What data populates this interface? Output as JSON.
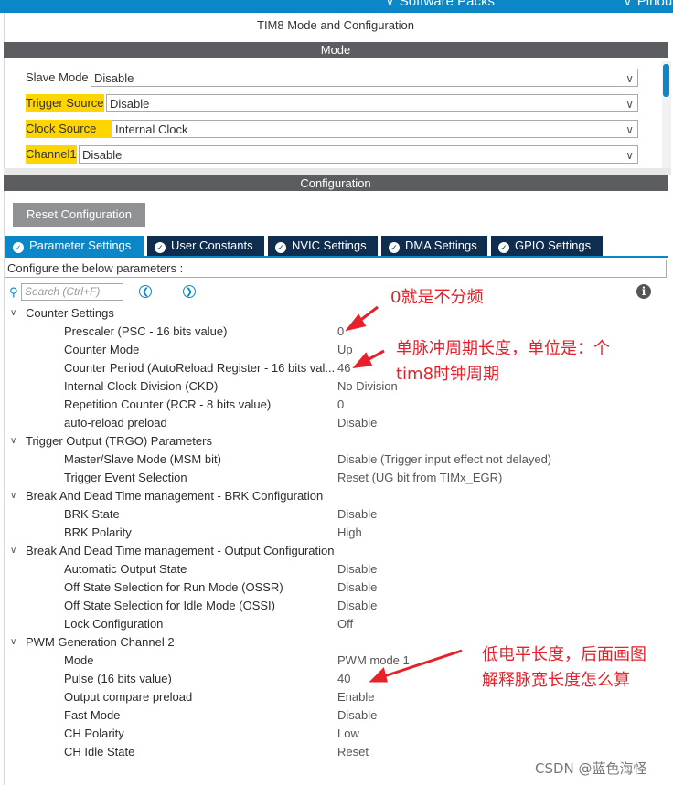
{
  "topbar": {
    "software_packs": "Software Packs",
    "pinout": "Pinou"
  },
  "title": "TIM8 Mode and Configuration",
  "mode_header": "Mode",
  "mode_rows": [
    {
      "label": "Slave Mode",
      "value": "Disable"
    },
    {
      "label": "Trigger Source",
      "value": "Disable"
    },
    {
      "label": "Clock Source",
      "value": "Internal Clock"
    },
    {
      "label": "Channel1",
      "value": "Disable"
    }
  ],
  "config_header": "Configuration",
  "reset_button": "Reset Configuration",
  "tabs": [
    "Parameter Settings",
    "User Constants",
    "NVIC Settings",
    "DMA Settings",
    "GPIO Settings"
  ],
  "description": "Configure the below parameters :",
  "search_placeholder": "Search (Ctrl+F)",
  "groups": [
    {
      "name": "Counter Settings",
      "params": [
        {
          "name": "Prescaler (PSC - 16 bits value)",
          "value": "0"
        },
        {
          "name": "Counter Mode",
          "value": "Up"
        },
        {
          "name": "Counter Period (AutoReload Register - 16 bits val...",
          "value": "46"
        },
        {
          "name": "Internal Clock Division (CKD)",
          "value": "No Division"
        },
        {
          "name": "Repetition Counter (RCR - 8 bits value)",
          "value": "0"
        },
        {
          "name": "auto-reload preload",
          "value": "Disable"
        }
      ]
    },
    {
      "name": "Trigger Output (TRGO) Parameters",
      "params": [
        {
          "name": "Master/Slave Mode (MSM bit)",
          "value": "Disable (Trigger input effect not delayed)"
        },
        {
          "name": "Trigger Event Selection",
          "value": "Reset (UG bit from TIMx_EGR)"
        }
      ]
    },
    {
      "name": "Break And Dead Time management - BRK Configuration",
      "params": [
        {
          "name": "BRK State",
          "value": "Disable"
        },
        {
          "name": "BRK Polarity",
          "value": "High"
        }
      ]
    },
    {
      "name": "Break And Dead Time management - Output Configuration",
      "params": [
        {
          "name": "Automatic Output State",
          "value": "Disable"
        },
        {
          "name": "Off State Selection for Run Mode (OSSR)",
          "value": "Disable"
        },
        {
          "name": "Off State Selection for Idle Mode (OSSI)",
          "value": "Disable"
        },
        {
          "name": "Lock Configuration",
          "value": "Off"
        }
      ]
    },
    {
      "name": "PWM Generation Channel 2",
      "params": [
        {
          "name": "Mode",
          "value": "PWM mode 1"
        },
        {
          "name": "Pulse (16 bits value)",
          "value": "40"
        },
        {
          "name": "Output compare preload",
          "value": "Enable"
        },
        {
          "name": "Fast Mode",
          "value": "Disable"
        },
        {
          "name": "CH Polarity",
          "value": "Low"
        },
        {
          "name": "CH Idle State",
          "value": "Reset"
        }
      ]
    }
  ],
  "annotations": {
    "a1": "0就是不分频",
    "a2_line1": "单脉冲周期长度，单位是：个",
    "a2_line2": "tim8时钟周期",
    "a3_line1": "低电平长度，后面画图",
    "a3_line2": "解释脉宽长度怎么算"
  },
  "watermark": "CSDN @蓝色海怪",
  "colors": {
    "accent": "#0b86c7",
    "tab_dark": "#0e2d4f",
    "highlight": "#ffd500",
    "annotation": "#e8202a"
  }
}
